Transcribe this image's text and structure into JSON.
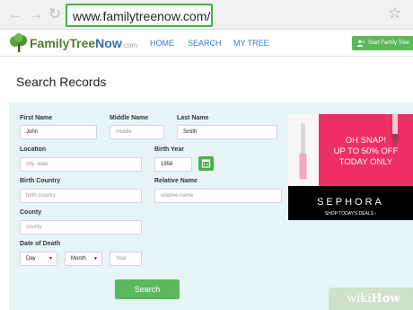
{
  "browser": {
    "url": "www.familytreenow.com/",
    "icons": [
      "back-arrow-icon",
      "forward-arrow-icon",
      "reload-icon",
      "star-icon"
    ]
  },
  "header": {
    "logo_family": "FamilyTree",
    "logo_now": "Now",
    "logo_suffix": ".com",
    "nav": [
      "HOME",
      "SEARCH",
      "MY TREE"
    ],
    "start_button": "Start Family Tree",
    "colors": {
      "logo_green": "#4a7c2f",
      "logo_blue": "#2e6fa8",
      "nav_blue": "#3a7bbf",
      "button_green": "#5cb85c"
    }
  },
  "page": {
    "title": "Search Records"
  },
  "form": {
    "first_name": {
      "label": "First Name",
      "value": "John"
    },
    "middle_name": {
      "label": "Middle Name",
      "placeholder": "middle"
    },
    "last_name": {
      "label": "Last Name",
      "value": "Smith"
    },
    "location": {
      "label": "Location",
      "placeholder": "city, state"
    },
    "birth_year": {
      "label": "Birth Year",
      "value": "1958"
    },
    "birth_country": {
      "label": "Birth Country",
      "placeholder": "birth country"
    },
    "relative_name": {
      "label": "Relative Name",
      "placeholder": "relative name"
    },
    "county": {
      "label": "County",
      "placeholder": "county"
    },
    "date_of_death": {
      "label": "Date of Death",
      "day": "Day",
      "month": "Month",
      "year_placeholder": "Year"
    },
    "search_button": "Search",
    "panel_color": "#e7f4f6"
  },
  "ad": {
    "line1": "OH SNAP!",
    "line2": "UP TO 50% OFF",
    "line3": "TODAY ONLY",
    "brand": "SEPHORA",
    "cta": "SHOP TODAY'S DEALS ›",
    "colors": {
      "pink": "#ee2f63",
      "black": "#000000"
    }
  },
  "watermark": {
    "text_wiki": "wiki",
    "text_how": "How"
  }
}
